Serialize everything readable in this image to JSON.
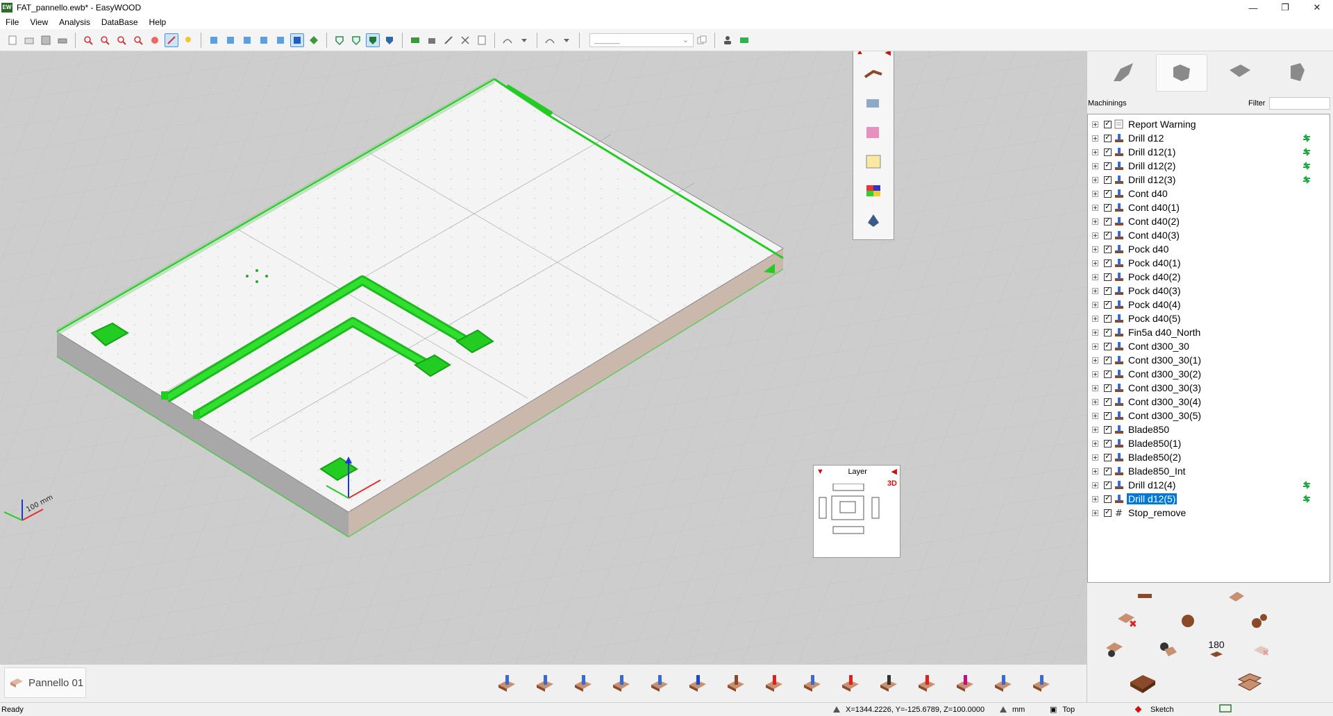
{
  "window": {
    "title": "FAT_pannello.ewb* - EasyWOOD",
    "app_icon_text": "EW",
    "controls": [
      "minimize-icon",
      "maximize-icon",
      "close-icon"
    ]
  },
  "menu": {
    "items": [
      "File",
      "View",
      "Analysis",
      "DataBase",
      "Help"
    ]
  },
  "toolbar": {
    "select_value": "______",
    "icons": [
      "new-icon",
      "open-icon",
      "save-icon",
      "print-icon",
      "zoom-window-icon",
      "zoom-in-icon",
      "zoom-out-icon",
      "zoom-all-icon",
      "pan-icon",
      "measure-icon",
      "light-icon",
      "view-iso1-icon",
      "view-iso2-icon",
      "view-iso3-icon",
      "view-iso4-icon",
      "view-iso5-icon",
      "view-3d-icon",
      "view-rotate-icon",
      "shade-wire-icon",
      "shade-edge-icon",
      "shade-solid-icon",
      "shade-color-icon",
      "rect-icon",
      "machine-icon",
      "tool-icon",
      "cross-icon",
      "report-icon",
      "arc-icon",
      "arc-dropdown-icon",
      "shape-icon",
      "shape-dropdown-icon",
      "copy-icon",
      "user-icon",
      "mail-icon"
    ]
  },
  "view_palette": {
    "icons": [
      "eject-icon",
      "collapse-icon",
      "tool-holder-icon",
      "spray-icon",
      "layers-icon",
      "notes-icon",
      "palette-icon",
      "bucket-icon"
    ]
  },
  "right_panel": {
    "tabs": [
      "machine-tab-icon",
      "part-tab-icon",
      "piece-tab-icon",
      "clamp-tab-icon"
    ],
    "machinings_label": "Machinings",
    "filter_label": "Filter",
    "filter_value": "",
    "tree": [
      {
        "label": "Report Warning",
        "type": "report",
        "status": false
      },
      {
        "label": "Drill d12",
        "type": "drill",
        "status": true
      },
      {
        "label": "Drill d12(1)",
        "type": "drill",
        "status": true
      },
      {
        "label": "Drill d12(2)",
        "type": "drill",
        "status": true
      },
      {
        "label": "Drill d12(3)",
        "type": "drill",
        "status": true
      },
      {
        "label": "Cont d40",
        "type": "cont",
        "status": false
      },
      {
        "label": "Cont d40(1)",
        "type": "cont",
        "status": false
      },
      {
        "label": "Cont d40(2)",
        "type": "cont",
        "status": false
      },
      {
        "label": "Cont d40(3)",
        "type": "cont",
        "status": false
      },
      {
        "label": "Pock d40",
        "type": "pock",
        "status": false
      },
      {
        "label": "Pock d40(1)",
        "type": "pock",
        "status": false
      },
      {
        "label": "Pock d40(2)",
        "type": "pock",
        "status": false
      },
      {
        "label": "Pock d40(3)",
        "type": "pock",
        "status": false
      },
      {
        "label": "Pock d40(4)",
        "type": "pock",
        "status": false
      },
      {
        "label": "Pock d40(5)",
        "type": "pock",
        "status": false
      },
      {
        "label": "Fin5a d40_North",
        "type": "fin",
        "status": false
      },
      {
        "label": "Cont d300_30",
        "type": "cont",
        "status": false
      },
      {
        "label": "Cont d300_30(1)",
        "type": "cont",
        "status": false
      },
      {
        "label": "Cont d300_30(2)",
        "type": "cont",
        "status": false
      },
      {
        "label": "Cont d300_30(3)",
        "type": "cont",
        "status": false
      },
      {
        "label": "Cont d300_30(4)",
        "type": "cont",
        "status": false
      },
      {
        "label": "Cont d300_30(5)",
        "type": "cont",
        "status": false
      },
      {
        "label": "Blade850",
        "type": "blade",
        "status": false
      },
      {
        "label": "Blade850(1)",
        "type": "blade",
        "status": false
      },
      {
        "label": "Blade850(2)",
        "type": "blade",
        "status": false
      },
      {
        "label": "Blade850_Int",
        "type": "blade",
        "status": false
      },
      {
        "label": "Drill d12(4)",
        "type": "drill",
        "status": true
      },
      {
        "label": "Drill d12(5)",
        "type": "drill",
        "status": true,
        "selected": true
      },
      {
        "label": "Stop_remove",
        "type": "stop",
        "status": false
      }
    ],
    "commands": {
      "rotate_label": "180",
      "icons": [
        "minus-icon",
        "edit-piece-icon",
        "delete-piece-icon",
        "refresh-icon",
        "settings-icon",
        "piece-settings-icon",
        "piece-tool-icon",
        "rotate-180-icon",
        "delete-faded-icon",
        "corner-piece-icon",
        "stack-piece-icon"
      ]
    }
  },
  "layer_widget": {
    "title": "Layer",
    "mode": "3D"
  },
  "axis": {
    "scale_label": "100 mm"
  },
  "bottom": {
    "panel_tab_label": "Pannello 01",
    "op_tools": [
      "vertical-drill-tool-icon",
      "horizontal-drill-tool-icon",
      "router-tool-icon",
      "cont-tool-icon",
      "pocket-tool-icon",
      "disk-tool-icon",
      "blade-tool-icon",
      "cut-tool-icon",
      "plane-tool-icon",
      "chamfer-tool-icon",
      "macro-tool-icon",
      "s-tool-icon",
      "m-tool-icon",
      "drill-blue-tool-icon",
      "custom-tool-icon"
    ]
  },
  "status": {
    "ready": "Ready",
    "coords": "X=1344.2226, Y=-125.6789, Z=100.0000",
    "units": "mm",
    "view": "Top",
    "mode": "Sketch"
  },
  "colors": {
    "machining_green": "#22cc22",
    "panel_top": "#f4f4f4",
    "background": "#cfcfcf",
    "selection_blue": "#0078d7"
  }
}
